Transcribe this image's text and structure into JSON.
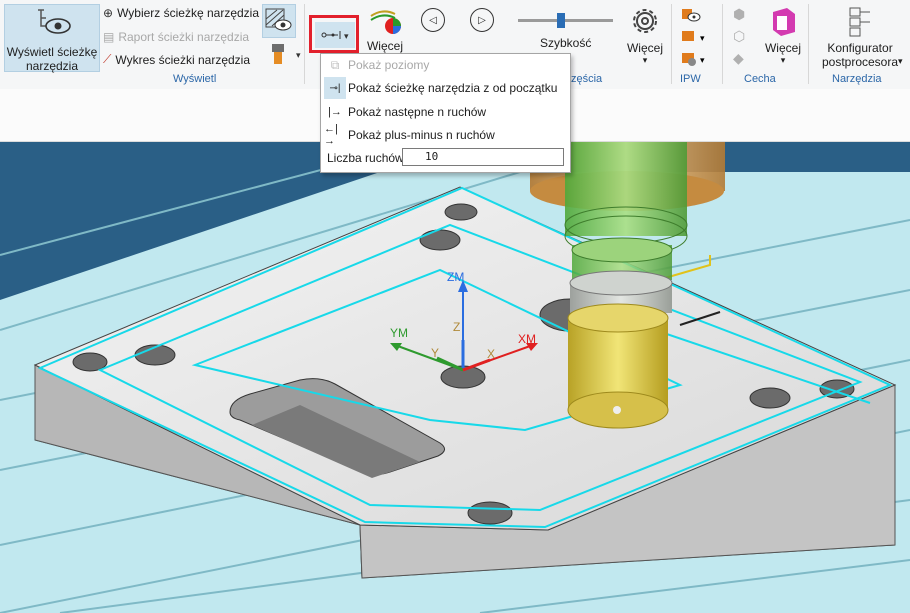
{
  "ribbon": {
    "show_toolpath_button": "Wyświetl ścieżkę\nnarzędzia",
    "select_toolpath": "Wybierz ścieżkę narzędzia",
    "toolpath_report": "Raport ścieżki narzędzia",
    "toolpath_chart": "Wykres ścieżki narzędzia",
    "group_display": "Wyświetl",
    "more_label_partial": "Więcej",
    "speed_label": "Szybkość",
    "more1": "Więcej",
    "group_ipw": "IPW",
    "group_feature": "Cecha",
    "more2": "Więcej",
    "postproc_configurator": "Konfigurator\npostprocesora",
    "group_tools": "Narzędzia",
    "group_partial": "zęścia"
  },
  "dropdown_menu": {
    "items": [
      {
        "label": "Pokaż poziomy",
        "disabled": true
      },
      {
        "label": "Pokaż ścieżkę narzędzia z od początku",
        "disabled": false
      },
      {
        "label": "Pokaż następne n ruchów",
        "disabled": false
      },
      {
        "label": "Pokaż plus-minus n ruchów",
        "disabled": false
      }
    ],
    "moves_count_label": "Liczba ruchów",
    "moves_count_value": "10"
  },
  "viewport": {
    "axis_zm": "ZM",
    "axis_ym": "YM",
    "axis_xm": "XM",
    "axis_z": "Z",
    "axis_y": "Y",
    "axis_x": "X"
  }
}
